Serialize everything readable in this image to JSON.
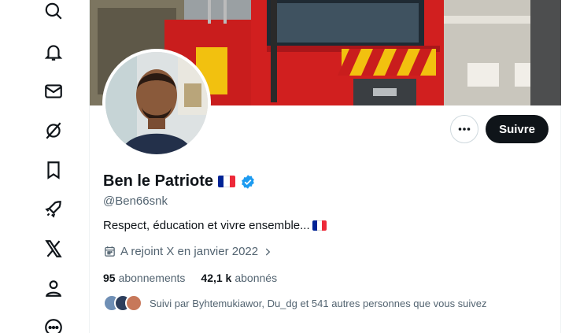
{
  "nav": {
    "items": [
      {
        "name": "explore",
        "icon": "search-icon"
      },
      {
        "name": "notifications",
        "icon": "bell-icon"
      },
      {
        "name": "messages",
        "icon": "mail-icon"
      },
      {
        "name": "grok",
        "icon": "grok-icon"
      },
      {
        "name": "bookmarks",
        "icon": "bookmark-icon"
      },
      {
        "name": "premium",
        "icon": "rocket-icon"
      },
      {
        "name": "x-premium",
        "icon": "x-logo-icon"
      },
      {
        "name": "profile",
        "icon": "person-icon"
      },
      {
        "name": "more",
        "icon": "more-circle-icon"
      }
    ]
  },
  "profile": {
    "display_name": "Ben le Patriote",
    "handle": "@Ben66snk",
    "bio": "Respect, éducation et vivre ensemble...",
    "joined": "A rejoint X en janvier 2022",
    "following_count": "95",
    "following_label": "abonnements",
    "followers_count": "42,1 k",
    "followers_label": "abonnés",
    "followed_by": "Suivi par Byhtemukiawor, Du_dg et 541 autres personnes que vous suivez"
  },
  "actions": {
    "follow_label": "Suivre",
    "more_icon": "more-horizontal-icon"
  },
  "colors": {
    "follow_bg": "#0f1419",
    "verified_blue": "#1d9bf0",
    "secondary_text": "#536471",
    "flag_blue": "#002395",
    "flag_white": "#ffffff",
    "flag_red": "#ed2939"
  }
}
